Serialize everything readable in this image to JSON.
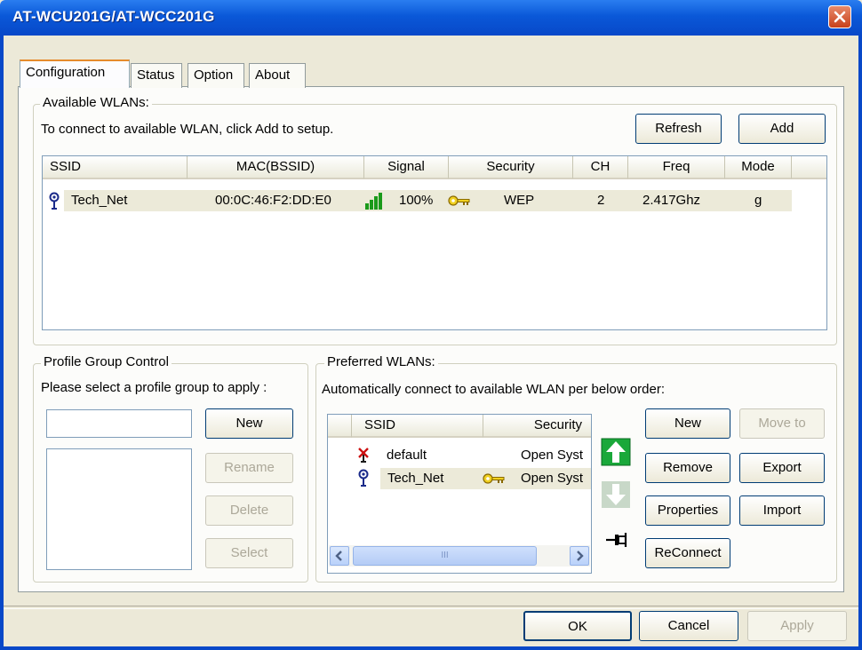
{
  "window": {
    "title": "AT-WCU201G/AT-WCC201G"
  },
  "tabs": [
    {
      "label": "Configuration"
    },
    {
      "label": "Status"
    },
    {
      "label": "Option"
    },
    {
      "label": "About"
    }
  ],
  "available": {
    "legend": "Available WLANs:",
    "hint": "To connect to available WLAN, click Add to setup.",
    "refresh_label": "Refresh",
    "add_label": "Add",
    "columns": [
      "SSID",
      "MAC(BSSID)",
      "Signal",
      "Security",
      "CH",
      "Freq",
      "Mode"
    ],
    "rows": [
      {
        "ssid": "Tech_Net",
        "mac": "00:0C:46:F2:DD:E0",
        "signal": "100%",
        "security": "WEP",
        "ch": "2",
        "freq": "2.417Ghz",
        "mode": "g"
      }
    ]
  },
  "profile_group": {
    "legend": "Profile Group Control",
    "hint": "Please select a profile group to apply :",
    "input_value": "",
    "new_label": "New",
    "rename_label": "Rename",
    "delete_label": "Delete",
    "select_label": "Select"
  },
  "preferred": {
    "legend": "Preferred WLANs:",
    "hint": "Automatically connect to available WLAN per below order:",
    "columns": [
      "SSID",
      "Security"
    ],
    "rows": [
      {
        "ssid": "default",
        "security": "Open Syst"
      },
      {
        "ssid": "Tech_Net",
        "security": "Open Syst"
      }
    ],
    "scroll_grip": "III",
    "new_label": "New",
    "move_to_label": "Move to",
    "remove_label": "Remove",
    "export_label": "Export",
    "properties_label": "Properties",
    "import_label": "Import",
    "reconnect_label": "ReConnect"
  },
  "footer": {
    "ok_label": "OK",
    "cancel_label": "Cancel",
    "apply_label": "Apply"
  },
  "colors": {
    "titlebar": "#0a58d8",
    "close": "#c8401a",
    "selection": "#ecead9",
    "signal": "#1a9a1a",
    "arrow_up": "#1aa83a"
  },
  "icons": [
    "close-icon",
    "antenna-icon",
    "signal-bars-icon",
    "key-icon",
    "disconnected-antenna-icon",
    "move-up-icon",
    "move-down-icon",
    "pin-icon",
    "scroll-left-icon",
    "scroll-right-icon"
  ]
}
